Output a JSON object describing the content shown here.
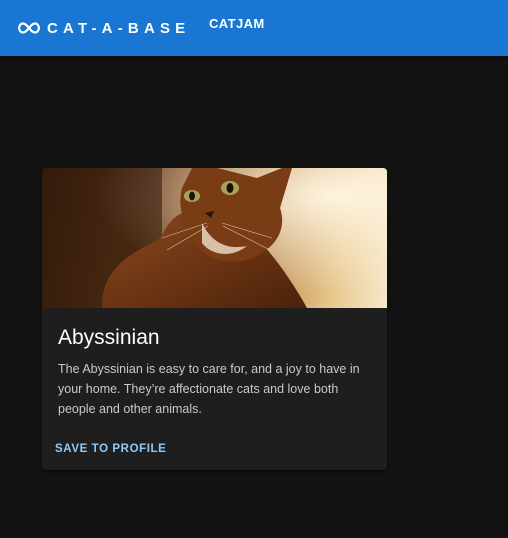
{
  "appbar": {
    "brand": "CAT-A-BASE",
    "logo_icon": "infinity-icon",
    "nav_link": "CATJAM",
    "color": "#1976d2"
  },
  "card": {
    "image_alt": "Abyssinian cat",
    "title": "Abyssinian",
    "description": "The Abyssinian is easy to care for, and a joy to have in your home. They’re affectionate cats and love both people and other animals.",
    "action_label": "SAVE TO PROFILE",
    "action_color": "#90caf9"
  },
  "page_background": "#121212"
}
